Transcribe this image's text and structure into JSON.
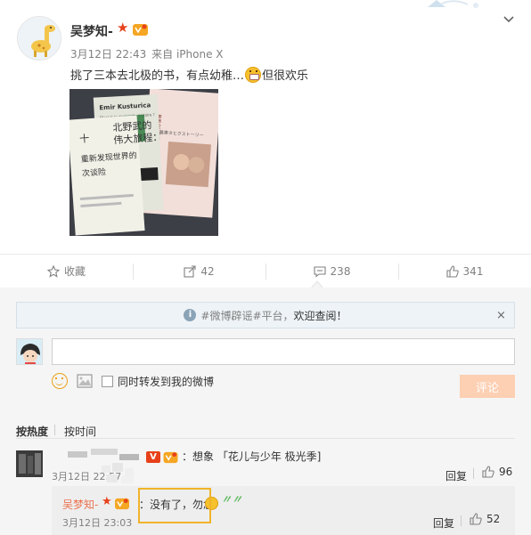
{
  "post": {
    "user_name": "吴梦知-",
    "time": "3月12日 22:43",
    "source": "来自 iPhone X",
    "text_before": "挑了三本去北极的书，有点幼稚…",
    "text_after": "但很欢乐",
    "emoji": "grin-icon",
    "photo": {
      "book1_title": "Emir Kusturica",
      "book1_subtitle": "Où suis-je dans cette histoire ?",
      "book2_title_lines": [
        "北野武的",
        "伟大旅程：",
        "十",
        "重新发现世界的",
        "次谈险"
      ],
      "book3_title": "最果タヒクストーリー",
      "book3_spine": "最果夕比的温暖"
    }
  },
  "actions": {
    "favorite_label": "收藏",
    "repost_count": "42",
    "comment_count": "238",
    "like_count": "341"
  },
  "notice": {
    "icon": "info-icon",
    "prefix": "#微博辟谣#平台，",
    "link": "欢迎查阅！",
    "close": "×"
  },
  "composer": {
    "input_value": "",
    "repost_option": "同时转发到我的微博",
    "submit_label": "评论"
  },
  "sort": {
    "hot": "按热度",
    "time": "按时间"
  },
  "comments": [
    {
      "text": "：想象 「花儿与少年 极光季]",
      "time": "3月12日 22:57",
      "reply": "回复",
      "likes": "96"
    },
    {
      "user": "吴梦知-",
      "text": "：没有了，勿念",
      "time": "3月12日 23:03",
      "reply": "回复",
      "likes": "52"
    }
  ],
  "colors": {
    "accent_orange": "#eb7350",
    "highlight_box": "#f0b32a",
    "submit_disabled": "#fdcfb3"
  }
}
